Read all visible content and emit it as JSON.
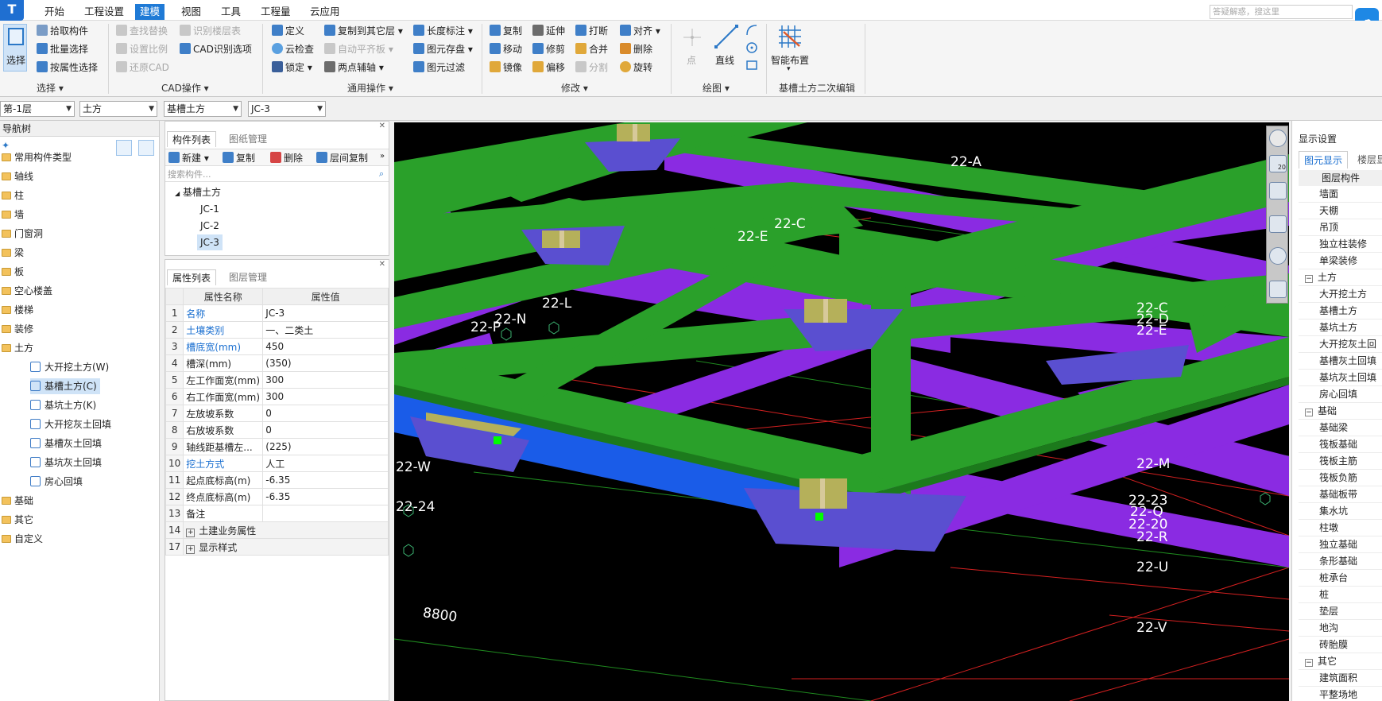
{
  "titlebar": {
    "logo": "T"
  },
  "menu_tabs": [
    "开始",
    "工程设置",
    "建模",
    "视图",
    "工具",
    "工程量",
    "云应用"
  ],
  "active_tab": "建模",
  "help_search": {
    "placeholder": "答疑解惑，搜这里"
  },
  "ribbon": {
    "select_big": "选择",
    "select_items": [
      "拾取构件",
      "批量选择",
      "按属性选择"
    ],
    "group_select": "选择",
    "cad_items_col1": [
      "查找替换",
      "设置比例",
      "还原CAD"
    ],
    "cad_items_col2": [
      "识别楼层表",
      "CAD识别选项"
    ],
    "group_cad": "CAD操作",
    "common_col1": [
      "定义",
      "云检查",
      "锁定"
    ],
    "common_col2": [
      "复制到其它层",
      "自动平齐板",
      "两点辅轴"
    ],
    "common_col3": [
      "长度标注",
      "图元存盘",
      "图元过滤"
    ],
    "group_common": "通用操作",
    "modify_col1": [
      "复制",
      "移动",
      "镜像"
    ],
    "modify_col2": [
      "延伸",
      "修剪",
      "偏移"
    ],
    "modify_col3": [
      "打断",
      "合并",
      "分割"
    ],
    "modify_col4": [
      "对齐",
      "删除",
      "旋转"
    ],
    "group_modify": "修改",
    "draw_point": "点",
    "draw_line": "直线",
    "group_draw": "绘图",
    "smart_layout": "智能布置",
    "group_edit2": "基槽土方二次编辑"
  },
  "filters": [
    "第-1层",
    "土方",
    "基槽土方",
    "JC-3"
  ],
  "nav": {
    "title": "导航树",
    "items": [
      "常用构件类型",
      "轴线",
      "柱",
      "墙",
      "门窗洞",
      "梁",
      "板",
      "空心楼盖",
      "楼梯",
      "装修",
      "土方"
    ],
    "sub_items": [
      "大开挖土方(W)",
      "基槽土方(C)",
      "基坑土方(K)",
      "大开挖灰土回填",
      "基槽灰土回填",
      "基坑灰土回填",
      "房心回填"
    ],
    "after_items": [
      "基础",
      "其它",
      "自定义"
    ]
  },
  "complist": {
    "tab_on": "构件列表",
    "tab_off": "图纸管理",
    "toolbar": [
      "新建",
      "复制",
      "删除",
      "层间复制"
    ],
    "search_placeholder": "搜索构件...",
    "group": "基槽土方",
    "children": [
      "JC-1",
      "JC-2",
      "JC-3"
    ]
  },
  "proplist": {
    "tab_on": "属性列表",
    "tab_off": "图层管理",
    "col_name": "属性名称",
    "col_value": "属性值",
    "rows": [
      {
        "n": "1",
        "k": "名称",
        "v": "JC-3",
        "blue": true
      },
      {
        "n": "2",
        "k": "土壤类别",
        "v": "一、二类土",
        "blue": true
      },
      {
        "n": "3",
        "k": "槽底宽(mm)",
        "v": "450",
        "blue": true
      },
      {
        "n": "4",
        "k": "槽深(mm)",
        "v": "(350)",
        "blue": false
      },
      {
        "n": "5",
        "k": "左工作面宽(mm)",
        "v": "300",
        "blue": false
      },
      {
        "n": "6",
        "k": "右工作面宽(mm)",
        "v": "300",
        "blue": false
      },
      {
        "n": "7",
        "k": "左放坡系数",
        "v": "0",
        "blue": false
      },
      {
        "n": "8",
        "k": "右放坡系数",
        "v": "0",
        "blue": false
      },
      {
        "n": "9",
        "k": "轴线距基槽左...",
        "v": "(225)",
        "blue": false
      },
      {
        "n": "10",
        "k": "挖土方式",
        "v": "人工",
        "blue": true
      },
      {
        "n": "11",
        "k": "起点底标高(m)",
        "v": "-6.35",
        "blue": false
      },
      {
        "n": "12",
        "k": "终点底标高(m)",
        "v": "-6.35",
        "blue": false
      },
      {
        "n": "13",
        "k": "备注",
        "v": "",
        "blue": false
      },
      {
        "n": "14",
        "k": "土建业务属性",
        "v": "",
        "blue": false
      },
      {
        "n": "17",
        "k": "显示样式",
        "v": "",
        "blue": false
      }
    ]
  },
  "viewport_labels": [
    "22-A",
    "22-C",
    "22-E",
    "22-L",
    "22-N",
    "22-P",
    "22-W",
    "22-24",
    "8800",
    "22-C",
    "22-D",
    "22-E",
    "22-M",
    "22-23",
    "22-Q",
    "22-20",
    "22-R",
    "22-U",
    "22-V"
  ],
  "view_toolbar": {
    "zoom": "20"
  },
  "display": {
    "title": "显示设置",
    "tab_on": "图元显示",
    "tab_off": "楼层显示",
    "col": "图层构件",
    "items": [
      "墙面",
      "天棚",
      "吊顶",
      "独立柱装修",
      "单梁装修"
    ],
    "earth_group": "土方",
    "earth_items": [
      "大开挖土方",
      "基槽土方",
      "基坑土方",
      "大开挖灰土回",
      "基槽灰土回填",
      "基坑灰土回填",
      "房心回填"
    ],
    "found_group": "基础",
    "found_items": [
      "基础梁",
      "筏板基础",
      "筏板主筋",
      "筏板负筋",
      "基础板带",
      "集水坑",
      "柱墩",
      "独立基础",
      "条形基础",
      "桩承台",
      "桩",
      "垫层",
      "地沟",
      "砖胎膜"
    ],
    "other_group": "其它",
    "other_items": [
      "建筑面积",
      "平整场地"
    ]
  }
}
